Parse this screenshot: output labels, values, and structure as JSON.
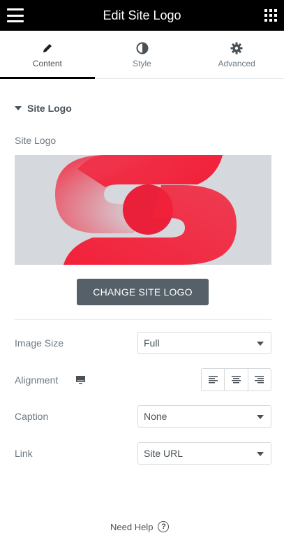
{
  "header": {
    "title": "Edit Site Logo",
    "menu_icon": "hamburger-menu-icon",
    "apps_icon": "grid-apps-icon"
  },
  "tabs": [
    {
      "label": "Content",
      "icon": "pencil-icon",
      "active": true
    },
    {
      "label": "Style",
      "icon": "half-circle-contrast-icon",
      "active": false
    },
    {
      "label": "Advanced",
      "icon": "gear-icon",
      "active": false
    }
  ],
  "section": {
    "title": "Site Logo",
    "expanded": true
  },
  "site_logo": {
    "label": "Site Logo",
    "change_button": "CHANGE SITE LOGO",
    "accent": "#f2213a",
    "background": "#d5d8dc"
  },
  "controls": {
    "image_size": {
      "label": "Image Size",
      "value": "Full"
    },
    "alignment": {
      "label": "Alignment",
      "device_icon": "desktop-monitor-icon",
      "options": [
        "align-left-icon",
        "align-center-icon",
        "align-right-icon"
      ]
    },
    "caption": {
      "label": "Caption",
      "value": "None"
    },
    "link": {
      "label": "Link",
      "value": "Site URL"
    }
  },
  "footer": {
    "help_label": "Need Help",
    "help_icon": "question-circle-icon"
  },
  "colors": {
    "header_bg": "#000000",
    "button_bg": "#556068",
    "text": "#6d7882"
  }
}
